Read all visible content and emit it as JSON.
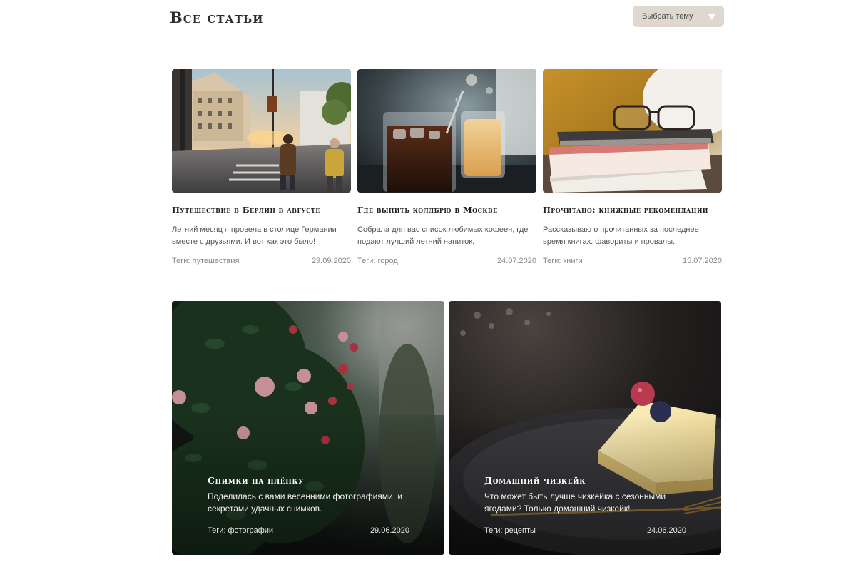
{
  "header": {
    "title": "Все статьи",
    "topic_select": "Выбрать тему"
  },
  "articles": [
    {
      "title": "Путешествие в Берлин в августе",
      "description": "Летний месяц я провела в столице Германии вместе с друзьями. И вот как это было!",
      "tags": "Теги: путешествия",
      "date": "29.09.2020"
    },
    {
      "title": "Где выпить колдбрю в Москве",
      "description": "Собрала для вас список любимых кофеен, где подают лучший летний напиток.",
      "tags": "Теги: город",
      "date": "24.07.2020"
    },
    {
      "title": "Прочитано: книжные рекомендации",
      "description": "Рассказываю о прочитанных за последнее время книгах: фавориты и провалы.",
      "tags": "Теги: книги",
      "date": "15.07.2020"
    }
  ],
  "featured": [
    {
      "title": "Снимки на плёнку",
      "description": "Поделилась с вами весенними фотографиями, и секретами удачных снимков.",
      "tags": "Теги: фотографии",
      "date": "29.06.2020"
    },
    {
      "title": "Домашний чизкейк",
      "description": "Что может быть лучше чизкейка с сезонными ягодами? Только домашний чизкейк!",
      "tags": "Теги: рецепты",
      "date": "24.06.2020"
    }
  ]
}
